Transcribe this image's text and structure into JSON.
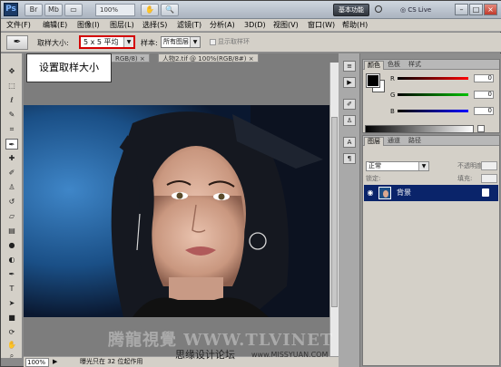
{
  "app": {
    "logo": "Ps"
  },
  "topbar": {
    "buttons": [
      "Br",
      "Mb",
      "▭",
      "✋",
      "🔍"
    ],
    "zoom": "100%",
    "workspace_label": "基本功能",
    "cs_live": "CS Live",
    "window_controls": [
      "–",
      "□",
      "×"
    ]
  },
  "menubar": {
    "items": [
      "文件(F)",
      "编辑(E)",
      "图像(I)",
      "图层(L)",
      "选择(S)",
      "滤镜(T)",
      "分析(A)",
      "3D(D)",
      "视图(V)",
      "窗口(W)",
      "帮助(H)"
    ]
  },
  "options": {
    "sample_size_label": "取样大小:",
    "sample_size_value": "5 x 5 平均",
    "sample_label": "样本:",
    "sample_value": "所有图层",
    "show_ring_label": "显示取样环"
  },
  "document": {
    "tabs": [
      "  RGB/8) ×",
      "人物2.tif @ 100%(RGB/8#) ×"
    ]
  },
  "callout": {
    "text": "设置取样大小"
  },
  "status": {
    "zoom": "100%",
    "text": "曝光只在 32 位起作用"
  },
  "color_panel": {
    "tabs": [
      "颜色",
      "色板",
      "样式"
    ],
    "channels": [
      {
        "label": "R",
        "value": "0",
        "gradient": "#ff0000"
      },
      {
        "label": "G",
        "value": "0",
        "gradient": "#00c000"
      },
      {
        "label": "B",
        "value": "0",
        "gradient": "#0000ff"
      }
    ]
  },
  "layers_panel": {
    "tabs": [
      "图层",
      "通道",
      "路径"
    ],
    "blend_mode": "正常",
    "opacity_label": "不透明度:",
    "opacity_value": "",
    "lock_label": "锁定:",
    "fill_label": "填充:",
    "fill_value": "",
    "layer_name": "背景"
  },
  "watermark": {
    "text": "腾龍視覺  WWW.TLVINET"
  },
  "footer": {
    "left": "思缘设计论坛",
    "right": "www.MISSYUAN.COM"
  }
}
